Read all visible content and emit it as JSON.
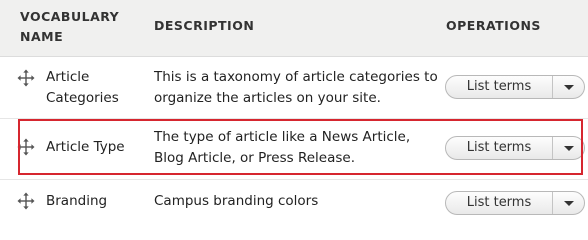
{
  "table": {
    "headers": {
      "vocabulary_line1": "VOCABULARY",
      "vocabulary_line2": "NAME",
      "description": "DESCRIPTION",
      "operations": "OPERATIONS"
    },
    "rows": [
      {
        "name_line1": "Article",
        "name_line2": "Categories",
        "desc_line1": "This is a taxonomy of article categories to",
        "desc_line2": "organize the articles on your site.",
        "button_label": "List terms"
      },
      {
        "name_line1": "Article Type",
        "name_line2": "",
        "desc_line1": "The type of article like a News Article,",
        "desc_line2": "Blog Article, or Press Release.",
        "button_label": "List terms",
        "highlighted": true
      },
      {
        "name_line1": "Branding",
        "name_line2": "",
        "desc_line1": "Campus branding colors",
        "desc_line2": "",
        "button_label": "List terms"
      }
    ]
  },
  "colors": {
    "highlight": "#d6262f",
    "header_bg": "#f0f0ef"
  },
  "icons": {
    "drag_handle": "move-arrows-icon",
    "dropdown": "caret-down-icon"
  }
}
